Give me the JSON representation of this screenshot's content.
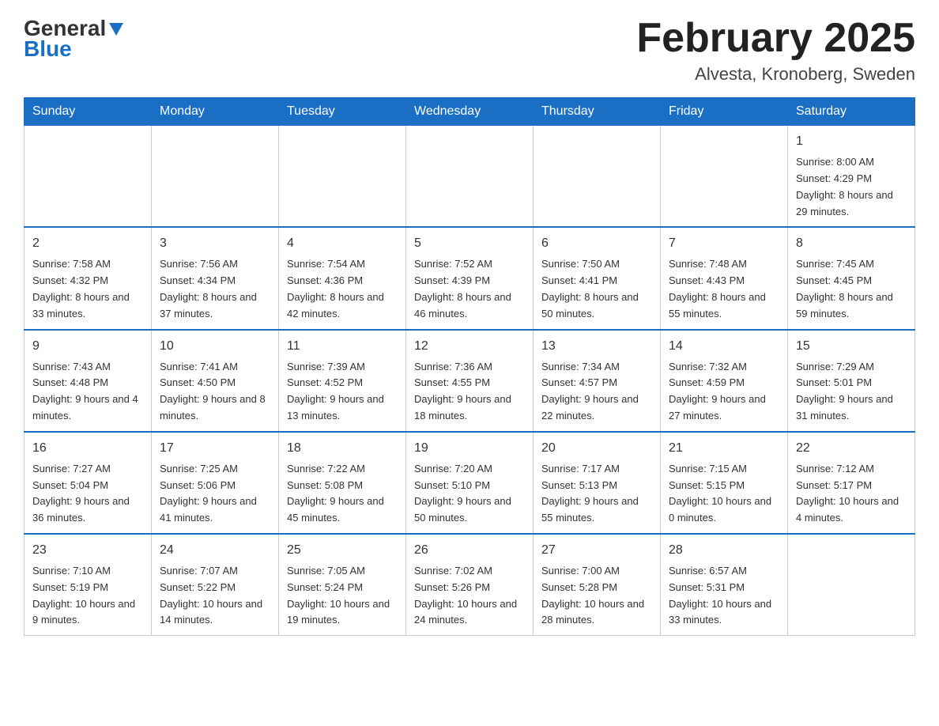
{
  "logo": {
    "text_general": "General",
    "text_blue": "Blue"
  },
  "header": {
    "month_title": "February 2025",
    "location": "Alvesta, Kronoberg, Sweden"
  },
  "days_of_week": [
    "Sunday",
    "Monday",
    "Tuesday",
    "Wednesday",
    "Thursday",
    "Friday",
    "Saturday"
  ],
  "weeks": [
    {
      "days": [
        {
          "number": "",
          "info": ""
        },
        {
          "number": "",
          "info": ""
        },
        {
          "number": "",
          "info": ""
        },
        {
          "number": "",
          "info": ""
        },
        {
          "number": "",
          "info": ""
        },
        {
          "number": "",
          "info": ""
        },
        {
          "number": "1",
          "info": "Sunrise: 8:00 AM\nSunset: 4:29 PM\nDaylight: 8 hours and 29 minutes."
        }
      ]
    },
    {
      "days": [
        {
          "number": "2",
          "info": "Sunrise: 7:58 AM\nSunset: 4:32 PM\nDaylight: 8 hours and 33 minutes."
        },
        {
          "number": "3",
          "info": "Sunrise: 7:56 AM\nSunset: 4:34 PM\nDaylight: 8 hours and 37 minutes."
        },
        {
          "number": "4",
          "info": "Sunrise: 7:54 AM\nSunset: 4:36 PM\nDaylight: 8 hours and 42 minutes."
        },
        {
          "number": "5",
          "info": "Sunrise: 7:52 AM\nSunset: 4:39 PM\nDaylight: 8 hours and 46 minutes."
        },
        {
          "number": "6",
          "info": "Sunrise: 7:50 AM\nSunset: 4:41 PM\nDaylight: 8 hours and 50 minutes."
        },
        {
          "number": "7",
          "info": "Sunrise: 7:48 AM\nSunset: 4:43 PM\nDaylight: 8 hours and 55 minutes."
        },
        {
          "number": "8",
          "info": "Sunrise: 7:45 AM\nSunset: 4:45 PM\nDaylight: 8 hours and 59 minutes."
        }
      ]
    },
    {
      "days": [
        {
          "number": "9",
          "info": "Sunrise: 7:43 AM\nSunset: 4:48 PM\nDaylight: 9 hours and 4 minutes."
        },
        {
          "number": "10",
          "info": "Sunrise: 7:41 AM\nSunset: 4:50 PM\nDaylight: 9 hours and 8 minutes."
        },
        {
          "number": "11",
          "info": "Sunrise: 7:39 AM\nSunset: 4:52 PM\nDaylight: 9 hours and 13 minutes."
        },
        {
          "number": "12",
          "info": "Sunrise: 7:36 AM\nSunset: 4:55 PM\nDaylight: 9 hours and 18 minutes."
        },
        {
          "number": "13",
          "info": "Sunrise: 7:34 AM\nSunset: 4:57 PM\nDaylight: 9 hours and 22 minutes."
        },
        {
          "number": "14",
          "info": "Sunrise: 7:32 AM\nSunset: 4:59 PM\nDaylight: 9 hours and 27 minutes."
        },
        {
          "number": "15",
          "info": "Sunrise: 7:29 AM\nSunset: 5:01 PM\nDaylight: 9 hours and 31 minutes."
        }
      ]
    },
    {
      "days": [
        {
          "number": "16",
          "info": "Sunrise: 7:27 AM\nSunset: 5:04 PM\nDaylight: 9 hours and 36 minutes."
        },
        {
          "number": "17",
          "info": "Sunrise: 7:25 AM\nSunset: 5:06 PM\nDaylight: 9 hours and 41 minutes."
        },
        {
          "number": "18",
          "info": "Sunrise: 7:22 AM\nSunset: 5:08 PM\nDaylight: 9 hours and 45 minutes."
        },
        {
          "number": "19",
          "info": "Sunrise: 7:20 AM\nSunset: 5:10 PM\nDaylight: 9 hours and 50 minutes."
        },
        {
          "number": "20",
          "info": "Sunrise: 7:17 AM\nSunset: 5:13 PM\nDaylight: 9 hours and 55 minutes."
        },
        {
          "number": "21",
          "info": "Sunrise: 7:15 AM\nSunset: 5:15 PM\nDaylight: 10 hours and 0 minutes."
        },
        {
          "number": "22",
          "info": "Sunrise: 7:12 AM\nSunset: 5:17 PM\nDaylight: 10 hours and 4 minutes."
        }
      ]
    },
    {
      "days": [
        {
          "number": "23",
          "info": "Sunrise: 7:10 AM\nSunset: 5:19 PM\nDaylight: 10 hours and 9 minutes."
        },
        {
          "number": "24",
          "info": "Sunrise: 7:07 AM\nSunset: 5:22 PM\nDaylight: 10 hours and 14 minutes."
        },
        {
          "number": "25",
          "info": "Sunrise: 7:05 AM\nSunset: 5:24 PM\nDaylight: 10 hours and 19 minutes."
        },
        {
          "number": "26",
          "info": "Sunrise: 7:02 AM\nSunset: 5:26 PM\nDaylight: 10 hours and 24 minutes."
        },
        {
          "number": "27",
          "info": "Sunrise: 7:00 AM\nSunset: 5:28 PM\nDaylight: 10 hours and 28 minutes."
        },
        {
          "number": "28",
          "info": "Sunrise: 6:57 AM\nSunset: 5:31 PM\nDaylight: 10 hours and 33 minutes."
        },
        {
          "number": "",
          "info": ""
        }
      ]
    }
  ]
}
